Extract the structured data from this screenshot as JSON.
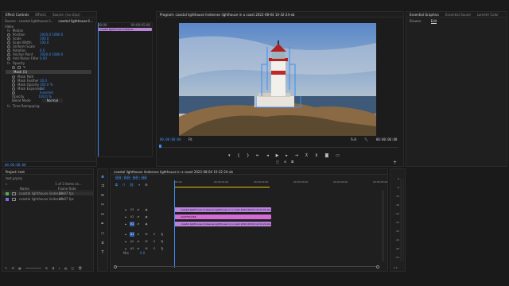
{
  "effect_controls": {
    "tabs": [
      "Effect Controls",
      "Effects",
      "Source: (no clips)"
    ],
    "active_tab": 0,
    "source_label": "Source · coastal lighthouse li...",
    "seq_label": "coastal lighthouse li...",
    "start_time": "00:00",
    "end_time": "00:00:05:00",
    "clip_bar_label": "coastal lighthouse lindesnes",
    "section_video": "Video",
    "motion": "Motion",
    "props": [
      {
        "name": "Position",
        "value": "1920.0   1080.0"
      },
      {
        "name": "Scale",
        "value": "100.0"
      },
      {
        "name": "Scale Width",
        "value": "100.0"
      },
      {
        "name": "Uniform Scale",
        "value": ""
      },
      {
        "name": "Rotation",
        "value": "0.0"
      },
      {
        "name": "Anchor Point",
        "value": "1920.0   1080.0"
      },
      {
        "name": "Anti-flicker Filter",
        "value": "0.00"
      }
    ],
    "opacity": "Opacity",
    "mask": "Mask (1)",
    "mask_props": [
      {
        "name": "Mask Path",
        "value": ""
      },
      {
        "name": "Mask Feather",
        "value": "10.0"
      },
      {
        "name": "Mask Opacity",
        "value": "100.0 %"
      },
      {
        "name": "Mask Expansion",
        "value": "0.0"
      },
      {
        "name": "",
        "value": "Inverted"
      }
    ],
    "opacity_value": "100.0 %",
    "blend_label": "Blend Mode",
    "blend_value": "Normal",
    "time_remap": "Time Remapping"
  },
  "program": {
    "title": "Program: coastal lighthouse lindesnes lighthouse in a coast 2022-08-04 10-32-24-xb",
    "timecode": "00:00:00:00",
    "fit": "Fit",
    "quality": "Full",
    "duration": "00:00:06:00"
  },
  "essential": {
    "tabs": [
      "Essential Graphics",
      "Essential Sound",
      "Lumetri Color"
    ],
    "subtabs": [
      "Browse",
      "Edit"
    ],
    "active_subtab": 1
  },
  "project": {
    "title": "Project: test",
    "file": "test.prproj",
    "count": "1 of 3 items se...",
    "col_name": "Name",
    "col_fps": "Frame Rate",
    "items": [
      {
        "name": "coastal lighthouse lindesnes",
        "fps": "29.97 fps",
        "color": "#4caf50"
      },
      {
        "name": "coastal lighthouse lindesnes",
        "fps": "29.97 fps",
        "color": "#7b68ee"
      }
    ]
  },
  "timeline": {
    "tab": "coastal lighthouse lindesnes lighthouse in a coast 2022-08-04 10-32-24-xb",
    "timecode": "00:00:00:00",
    "ruler": [
      ":00:00",
      "00:00:01:00",
      "00:00:02:00",
      "00:00:03:00",
      "00:00:04:00",
      "00:00:05:00"
    ],
    "tracks_v": [
      "V3",
      "V2",
      "V1"
    ],
    "tracks_a": [
      "A1",
      "A2",
      "A3"
    ],
    "mix": "Mix",
    "mix_value": "0.0",
    "clips": [
      {
        "label": "coastal lighthouse lindesnes lighthouse in a coast 2022-08-04 10-32-24-xb.mov",
        "color": "#b983d8"
      },
      {
        "label": "LIGHTHOUSE",
        "color": "#d46bd6"
      },
      {
        "label": "coastal lighthouse lindesnes lighthouse in a coast 2022-08-04 10-32-24-xb.mov",
        "color": "#b983d8"
      }
    ]
  },
  "meter": {
    "db": [
      "0",
      "-6",
      "-12",
      "-18",
      "-24",
      "-30",
      "-36",
      "-42",
      "-48",
      "-54"
    ],
    "bottom": "S  S"
  }
}
